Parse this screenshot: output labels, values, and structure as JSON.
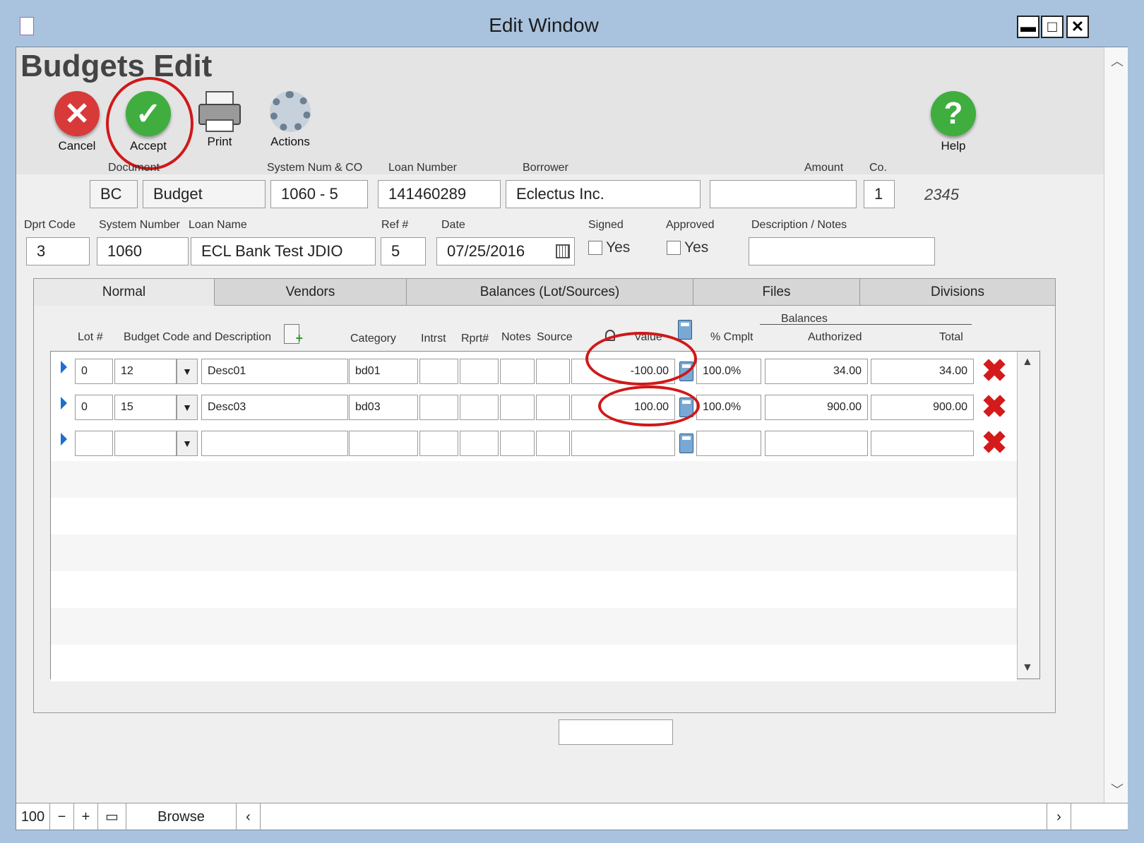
{
  "window": {
    "title": "Edit Window",
    "min": "▬",
    "max": "□",
    "close": "✕"
  },
  "page": {
    "title": "Budgets Edit"
  },
  "toolbar": {
    "cancel": "Cancel",
    "accept": "Accept",
    "print": "Print",
    "actions": "Actions",
    "help": "Help"
  },
  "header_fields": {
    "document_label": "Document",
    "document_code": "BC",
    "document_type": "Budget",
    "system_num_co_label": "System Num & CO",
    "system_num_co": "1060 - 5",
    "loan_number_label": "Loan Number",
    "loan_number": "141460289",
    "borrower_label": "Borrower",
    "borrower": "Eclectus Inc.",
    "amount_label": "Amount",
    "amount": "",
    "co_label": "Co.",
    "co": "1",
    "co_extra": "2345"
  },
  "detail_fields": {
    "dprt_code_label": "Dprt Code",
    "dprt_code": "3",
    "system_number_label": "System Number",
    "system_number": "1060",
    "loan_name_label": "Loan Name",
    "loan_name": "ECL Bank Test JDIO",
    "ref_label": "Ref #",
    "ref": "5",
    "date_label": "Date",
    "date": "07/25/2016",
    "signed_label": "Signed",
    "signed_yes": "Yes",
    "approved_label": "Approved",
    "approved_yes": "Yes",
    "notes_label": "Description / Notes",
    "notes": ""
  },
  "tabs": [
    "Normal",
    "Vendors",
    "Balances (Lot/Sources)",
    "Files",
    "Divisions"
  ],
  "columns": {
    "lot": "Lot #",
    "budget_code": "Budget Code and Description",
    "category": "Category",
    "intrst": "Intrst",
    "rprt": "Rprt#",
    "notes": "Notes",
    "source": "Source",
    "value": "Value",
    "balances": "Balances",
    "pct": "% Cmplt",
    "authorized": "Authorized",
    "total": "Total"
  },
  "rows": [
    {
      "lot": "0",
      "code": "12",
      "desc": "Desc01",
      "category": "bd01",
      "value": "-100.00",
      "pct": "100.0%",
      "authorized": "34.00",
      "total": "34.00"
    },
    {
      "lot": "0",
      "code": "15",
      "desc": "Desc03",
      "category": "bd03",
      "value": "100.00",
      "pct": "100.0%",
      "authorized": "900.00",
      "total": "900.00"
    },
    {
      "lot": "",
      "code": "",
      "desc": "",
      "category": "",
      "value": "",
      "pct": "",
      "authorized": "",
      "total": ""
    }
  ],
  "statusbar": {
    "zoom": "100",
    "mode": "Browse"
  },
  "colors": {
    "accent_red": "#d01818",
    "title_bar": "#a9c3df",
    "row_arrow": "#1a6fd0"
  }
}
